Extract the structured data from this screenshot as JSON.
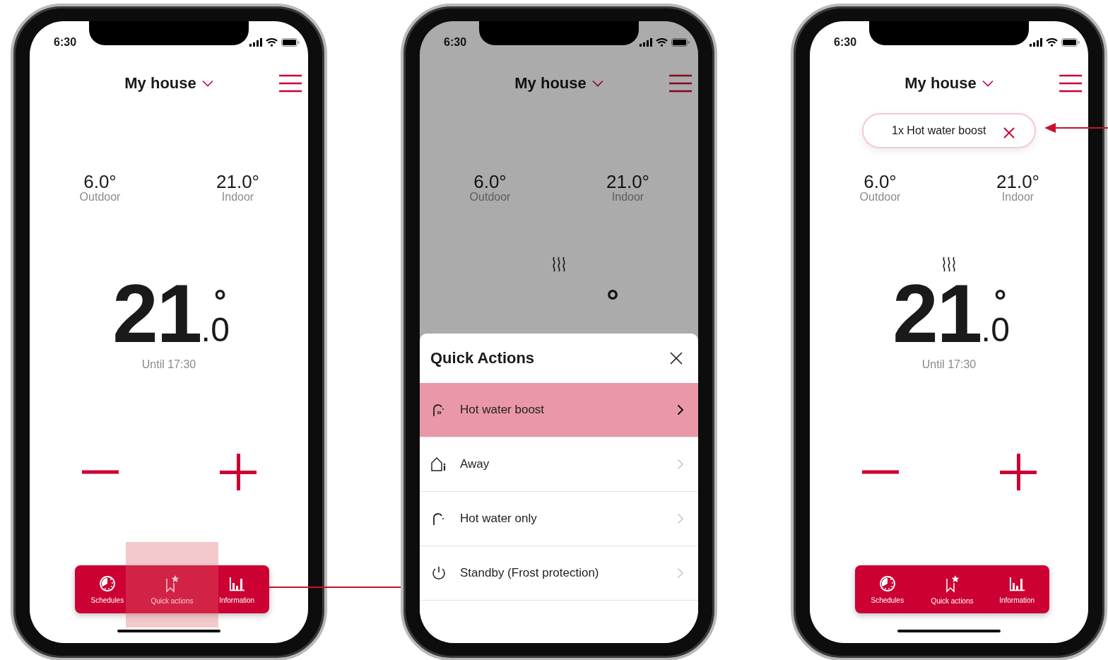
{
  "phones": [
    {
      "status_time": "6:30",
      "title": "My house",
      "dimmed": false,
      "readings": [
        {
          "value": "6.0°",
          "label": "Outdoor"
        },
        {
          "value": "21.0°",
          "label": "Indoor"
        }
      ],
      "heating": false,
      "setpoint": {
        "whole": "21",
        "decimal": ".",
        "fraction": "0",
        "unit": "°"
      },
      "until": "Until 17:30",
      "nav": [
        {
          "kind": "schedules",
          "label": "Schedules",
          "highlighted": false
        },
        {
          "kind": "quick",
          "label": "Quick actions",
          "highlighted": true
        },
        {
          "kind": "info",
          "label": "Information",
          "highlighted": false
        }
      ]
    },
    {
      "status_time": "6:30",
      "title": "My house",
      "dimmed": true,
      "readings": [
        {
          "value": "6.0°",
          "label": "Outdoor"
        },
        {
          "value": "21.0°",
          "label": "Indoor"
        }
      ],
      "heating": true,
      "setpoint": {
        "unit": "°"
      },
      "sheet": {
        "title": "Quick Actions",
        "items": [
          {
            "kind": "boost",
            "label": "Hot water boost",
            "selected": true
          },
          {
            "kind": "away",
            "label": "Away",
            "selected": false
          },
          {
            "kind": "water",
            "label": "Hot water only",
            "selected": false
          },
          {
            "kind": "standby",
            "label": "Standby (Frost protection)",
            "selected": false
          }
        ]
      }
    },
    {
      "status_time": "6:30",
      "title": "My house",
      "dimmed": false,
      "chip": {
        "text": "1x Hot water boost"
      },
      "readings": [
        {
          "value": "6.0°",
          "label": "Outdoor"
        },
        {
          "value": "21.0°",
          "label": "Indoor"
        }
      ],
      "heating": true,
      "setpoint": {
        "whole": "21",
        "decimal": ".",
        "fraction": "0",
        "unit": "°"
      },
      "until": "Until 17:30",
      "nav": [
        {
          "kind": "schedules",
          "label": "Schedules",
          "highlighted": false
        },
        {
          "kind": "quick",
          "label": "Quick actions",
          "highlighted": false
        },
        {
          "kind": "info",
          "label": "Information",
          "highlighted": false
        }
      ]
    }
  ]
}
